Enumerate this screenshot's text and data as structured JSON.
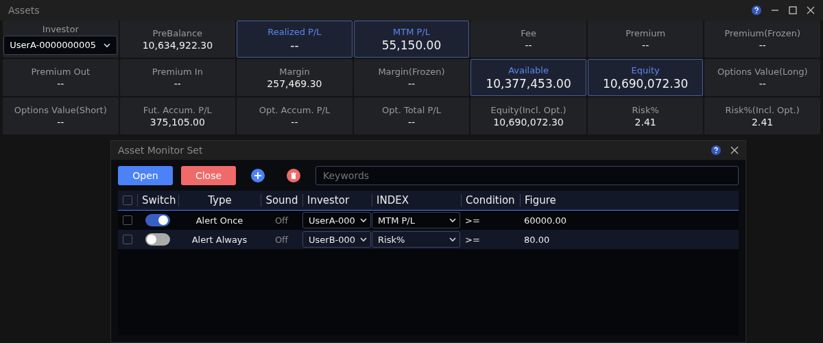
{
  "window": {
    "title": "Assets"
  },
  "cells": [
    {
      "kind": "select",
      "label": "Investor",
      "value": "UserA-0000000005",
      "highlighted": false
    },
    {
      "kind": "stat",
      "label": "PreBalance",
      "value": "10,634,922.30",
      "highlighted": false
    },
    {
      "kind": "stat",
      "label": "Realized P/L",
      "value": "--",
      "highlighted": true
    },
    {
      "kind": "stat",
      "label": "MTM P/L",
      "value": "55,150.00",
      "highlighted": true
    },
    {
      "kind": "stat",
      "label": "Fee",
      "value": "--",
      "highlighted": false
    },
    {
      "kind": "stat",
      "label": "Premium",
      "value": "--",
      "highlighted": false
    },
    {
      "kind": "stat",
      "label": "Premium(Frozen)",
      "value": "--",
      "highlighted": false
    },
    {
      "kind": "stat",
      "label": "Premium Out",
      "value": "--",
      "highlighted": false
    },
    {
      "kind": "stat",
      "label": "Premium In",
      "value": "--",
      "highlighted": false
    },
    {
      "kind": "stat",
      "label": "Margin",
      "value": "257,469.30",
      "highlighted": false
    },
    {
      "kind": "stat",
      "label": "Margin(Frozen)",
      "value": "--",
      "highlighted": false
    },
    {
      "kind": "stat",
      "label": "Available",
      "value": "10,377,453.00",
      "highlighted": true
    },
    {
      "kind": "stat",
      "label": "Equity",
      "value": "10,690,072.30",
      "highlighted": true
    },
    {
      "kind": "stat",
      "label": "Options Value(Long)",
      "value": "--",
      "highlighted": false
    },
    {
      "kind": "stat",
      "label": "Options Value(Short)",
      "value": "--",
      "highlighted": false
    },
    {
      "kind": "stat",
      "label": "Fut. Accum. P/L",
      "value": "375,105.00",
      "highlighted": false
    },
    {
      "kind": "stat",
      "label": "Opt. Accum. P/L",
      "value": "--",
      "highlighted": false
    },
    {
      "kind": "stat",
      "label": "Opt. Total P/L",
      "value": "--",
      "highlighted": false
    },
    {
      "kind": "stat",
      "label": "Equity(Incl. Opt.)",
      "value": "10,690,072.30",
      "highlighted": false
    },
    {
      "kind": "stat",
      "label": "Risk%",
      "value": "2.41",
      "highlighted": false
    },
    {
      "kind": "stat",
      "label": "Risk%(Incl. Opt.)",
      "value": "2.41",
      "highlighted": false
    }
  ],
  "dialog": {
    "title": "Asset Monitor Set",
    "buttons": [
      {
        "kind": "open",
        "label": "Open"
      },
      {
        "kind": "close",
        "label": "Close"
      }
    ],
    "search": {
      "placeholder": "Keywords"
    },
    "select_all_checked": false,
    "columns": [
      "Switch",
      "Type",
      "Sound",
      "Investor",
      "INDEX",
      "Condition",
      "Figure"
    ],
    "rows": [
      {
        "checked": false,
        "on": true,
        "type": "Alert Once",
        "sound": "Off",
        "investor": "UserA-000",
        "index": "MTM P/L",
        "condition": ">=",
        "figure": "60000.00"
      },
      {
        "checked": false,
        "on": false,
        "type": "Alert Always",
        "sound": "Off",
        "investor": "UserB-000",
        "index": "Risk%",
        "condition": ">=",
        "figure": "80.00"
      }
    ]
  }
}
